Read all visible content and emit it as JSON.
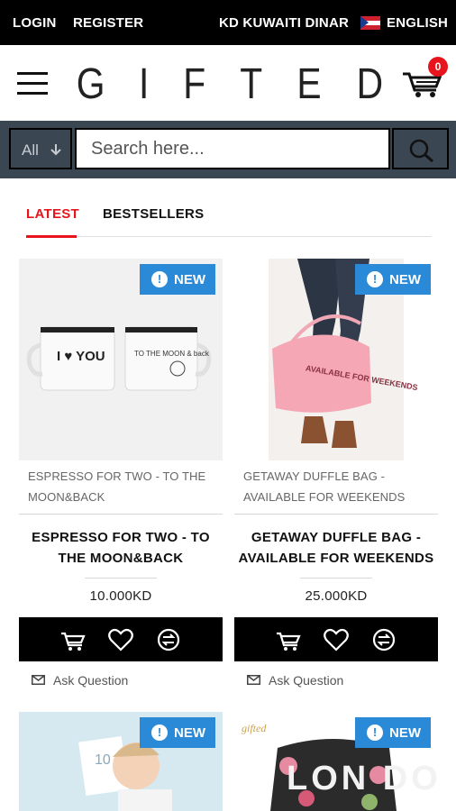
{
  "topbar": {
    "login": "LOGIN",
    "register": "REGISTER",
    "currency": "KD  KUWAITI DINAR",
    "language": "ENGLISH"
  },
  "header": {
    "logo_letters": [
      "G",
      "I",
      "F",
      "T",
      "E",
      "D"
    ],
    "cart_count": "0"
  },
  "search": {
    "category": "All",
    "placeholder": "Search here..."
  },
  "tabs": [
    {
      "label": "LATEST",
      "active": true
    },
    {
      "label": "BESTSELLERS",
      "active": false
    }
  ],
  "products": [
    {
      "badge": "NEW",
      "category": "ESPRESSO FOR TWO - TO THE MOON&BACK",
      "title": "ESPRESSO FOR TWO - TO THE MOON&BACK",
      "price": "10.000KD",
      "ask": "Ask Question",
      "mug_left_text": "I ♥ YOU",
      "mug_right_text": "TO THE MOON & back"
    },
    {
      "badge": "NEW",
      "category": "GETAWAY DUFFLE BAG - AVAILABLE FOR WEEKENDS",
      "title": "GETAWAY DUFFLE BAG - AVAILABLE FOR WEEKENDS",
      "price": "25.000KD",
      "ask": "Ask Question",
      "bag_text": "AVAILABLE FOR WEEKENDS"
    },
    {
      "badge": "NEW",
      "card_text": "10"
    },
    {
      "badge": "NEW",
      "logo_text": "gifted",
      "bag_text": "LON DON"
    }
  ],
  "colors": {
    "accent": "#e8141c",
    "badge": "#2a8ad8",
    "searchbar": "#3a4652",
    "topbar": "#000000"
  }
}
